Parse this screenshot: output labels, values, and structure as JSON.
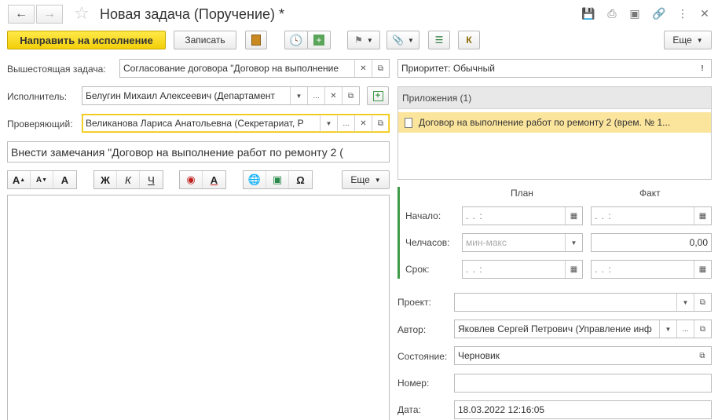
{
  "window": {
    "title": "Новая задача (Поручение) *"
  },
  "toolbar": {
    "send_label": "Направить на исполнение",
    "save_label": "Записать",
    "k_label": "К",
    "more_label": "Еще"
  },
  "form": {
    "parent_task_label": "Вышестоящая задача:",
    "parent_task_value": "Согласование договора \"Договор  на  выполнение",
    "executor_label": "Исполнитель:",
    "executor_value": "Белугин Михаил Алексеевич (Департамент",
    "checker_label": "Проверяющий:",
    "checker_value": "Великанова Лариса Анатольевна (Секретариат, Р",
    "subject_value": "Внести замечания \"Договор  на  выполнение работ по ремонту 2 (",
    "format_more_label": "Еще"
  },
  "right": {
    "priority_value": "Приоритет: Обычный",
    "attachments_title": "Приложения (1)",
    "attachment_item": "Договор  на  выполнение работ по ремонту 2 (врем. № 1...",
    "plan_label": "План",
    "fact_label": "Факт",
    "start_label": "Начало:",
    "hours_label": "Челчасов:",
    "deadline_label": "Срок:",
    "date_placeholder": "  .   .         :",
    "hours_placeholder": "мин-макс",
    "hours_fact_value": "0,00",
    "project_label": "Проект:",
    "project_value": "",
    "author_label": "Автор:",
    "author_value": "Яковлев Сергей Петрович (Управление инф",
    "state_label": "Состояние:",
    "state_value": "Черновик",
    "number_label": "Номер:",
    "number_value": "",
    "date_label": "Дата:",
    "date_value": "18.03.2022 12:16:05"
  }
}
